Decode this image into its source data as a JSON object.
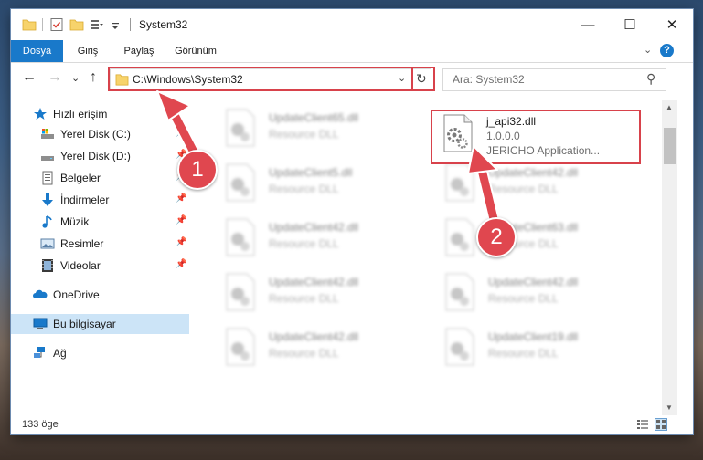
{
  "window": {
    "title": "System32",
    "controls": {
      "minimize": "—",
      "maximize": "☐",
      "close": "✕"
    }
  },
  "ribbon": {
    "tabs": [
      "Dosya",
      "Giriş",
      "Paylaş",
      "Görünüm"
    ],
    "expand_glyph": "⌄",
    "help_glyph": "?"
  },
  "nav": {
    "back_glyph": "←",
    "forward_glyph": "→",
    "recent_glyph": "⌄",
    "up_glyph": "↑",
    "address": "C:\\Windows\\System32",
    "address_dropdown_glyph": "⌄",
    "refresh_glyph": "↻",
    "search_placeholder": "Ara: System32",
    "search_glyph": "⚲"
  },
  "sidebar": {
    "items": [
      {
        "label": "Hızlı erişim",
        "icon": "star-icon",
        "pinned": false
      },
      {
        "label": "Yerel Disk (C:)",
        "icon": "drive-c-icon",
        "pinned": true
      },
      {
        "label": "Yerel Disk (D:)",
        "icon": "drive-d-icon",
        "pinned": true
      },
      {
        "label": "Belgeler",
        "icon": "documents-icon",
        "pinned": true
      },
      {
        "label": "İndirmeler",
        "icon": "downloads-icon",
        "pinned": true
      },
      {
        "label": "Müzik",
        "icon": "music-icon",
        "pinned": true
      },
      {
        "label": "Resimler",
        "icon": "pictures-icon",
        "pinned": true
      },
      {
        "label": "Videolar",
        "icon": "videos-icon",
        "pinned": true
      },
      {
        "label": "OneDrive",
        "icon": "cloud-icon",
        "pinned": false
      },
      {
        "label": "Bu bilgisayar",
        "icon": "computer-icon",
        "pinned": false,
        "selected": true
      },
      {
        "label": "Ağ",
        "icon": "network-icon",
        "pinned": false
      }
    ],
    "pin_glyph": "📌"
  },
  "files": [
    {
      "name": "UpdateClient65.dll",
      "desc": "Resource DLL",
      "blurred": true
    },
    {
      "name": "j_api32.dll",
      "version": "1.0.0.0",
      "desc": "JERICHO Application...",
      "blurred": false,
      "highlighted": true
    },
    {
      "name": "UpdateClient5.dll",
      "desc": "Resource DLL",
      "blurred": true
    },
    {
      "name": "UpdateClient42.dll",
      "desc": "Resource DLL",
      "blurred": true
    },
    {
      "name": "UpdateClient42.dll",
      "desc": "Resource DLL",
      "blurred": true
    },
    {
      "name": "UpdateClient63.dll",
      "desc": "Resource DLL",
      "blurred": true
    },
    {
      "name": "UpdateClient42.dll",
      "desc": "Resource DLL",
      "blurred": true
    },
    {
      "name": "UpdateClient42.dll",
      "desc": "Resource DLL",
      "blurred": true
    },
    {
      "name": "UpdateClient42.dll",
      "desc": "Resource DLL",
      "blurred": true
    },
    {
      "name": "UpdateClient19.dll",
      "desc": "Resource DLL",
      "blurred": true
    }
  ],
  "status": {
    "item_count": "133 öge"
  },
  "annotations": {
    "step1": "1",
    "step2": "2"
  },
  "colors": {
    "accent": "#1979ca",
    "highlight": "#d8424b",
    "callout": "#e0474f",
    "selected": "#cce4f7"
  }
}
